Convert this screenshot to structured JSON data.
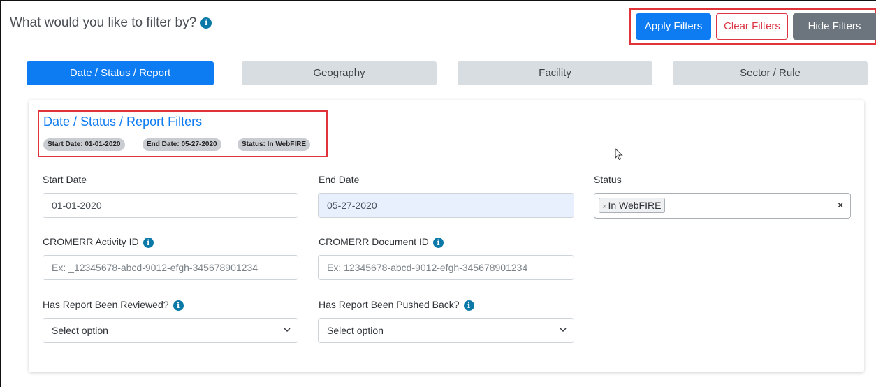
{
  "header": {
    "prompt": "What would you like to filter by?",
    "info_icon": "info-icon"
  },
  "actions": {
    "apply": "Apply Filters",
    "clear": "Clear Filters",
    "hide": "Hide Filters"
  },
  "tabs": [
    {
      "label": "Date / Status / Report",
      "active": true
    },
    {
      "label": "Geography",
      "active": false
    },
    {
      "label": "Facility",
      "active": false
    },
    {
      "label": "Sector / Rule",
      "active": false
    }
  ],
  "panel": {
    "title": "Date / Status / Report Filters",
    "badges": [
      "Start Date: 01-01-2020",
      "End Date: 05-27-2020",
      "Status: In WebFIRE"
    ]
  },
  "fields": {
    "start_date": {
      "label": "Start Date",
      "value": "01-01-2020"
    },
    "end_date": {
      "label": "End Date",
      "value": "05-27-2020"
    },
    "status": {
      "label": "Status",
      "selected": "In WebFIRE",
      "remove_symbol": "×",
      "clear_symbol": "×"
    },
    "activity_id": {
      "label": "CROMERR Activity ID",
      "placeholder": "Ex: _12345678-abcd-9012-efgh-345678901234"
    },
    "document_id": {
      "label": "CROMERR Document ID",
      "placeholder": "Ex: 12345678-abcd-9012-efgh-345678901234"
    },
    "reviewed": {
      "label": "Has Report Been Reviewed?",
      "selected": "Select option"
    },
    "pushed_back": {
      "label": "Has Report Been Pushed Back?",
      "selected": "Select option"
    }
  },
  "colors": {
    "primary": "#0d7bf2",
    "danger": "#dc3545",
    "secondary": "#6c757d",
    "highlight_border": "#e0343a"
  }
}
